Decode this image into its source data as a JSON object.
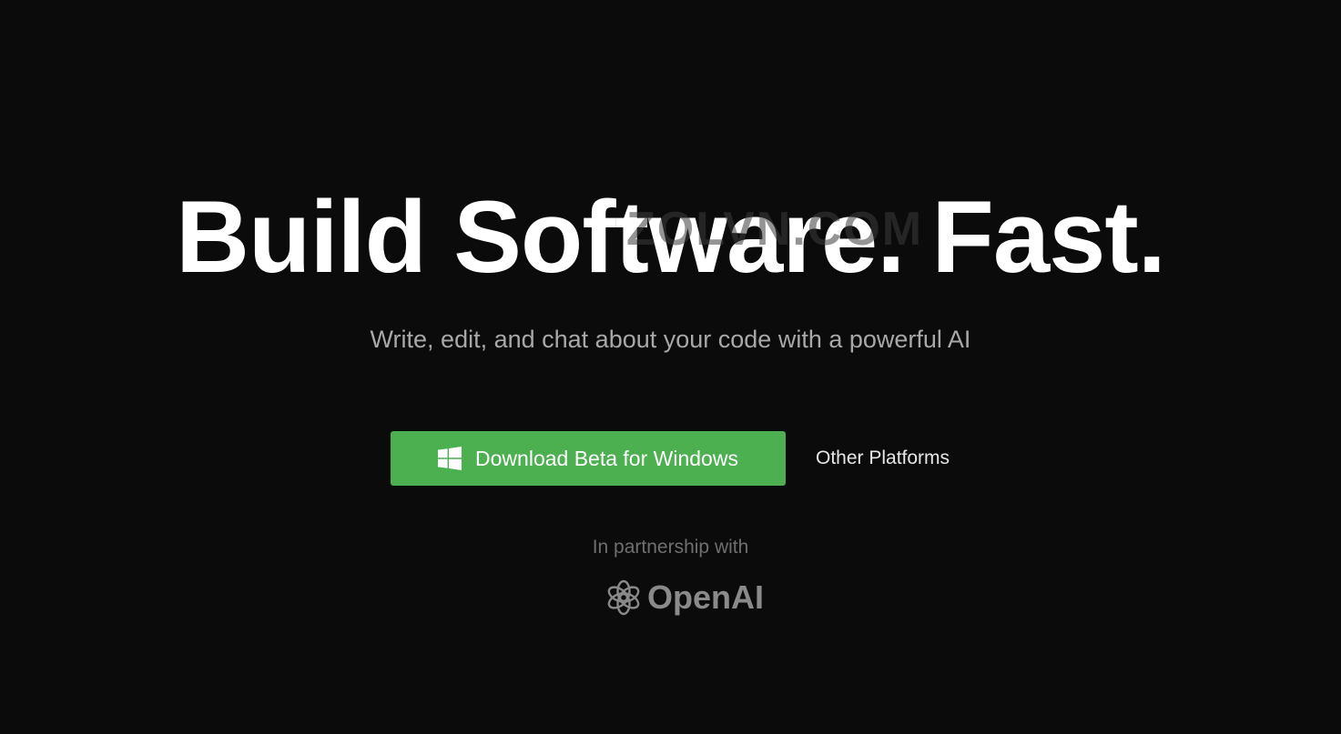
{
  "hero": {
    "title": "Build Software. Fast.",
    "subtitle": "Write, edit, and chat about your code with a powerful AI",
    "watermark": "ZOLVN.COM"
  },
  "cta": {
    "download_label": "Download Beta for Windows",
    "other_platforms_label": "Other Platforms",
    "icon": "windows-icon"
  },
  "partnership": {
    "label": "In partnership with",
    "partner_name": "OpenAI",
    "icon": "openai-icon"
  },
  "colors": {
    "background": "#0b0b0b",
    "accent": "#4caf50",
    "title": "#ffffff",
    "subtitle": "#a8a8a8",
    "muted": "#6f6f6f"
  }
}
